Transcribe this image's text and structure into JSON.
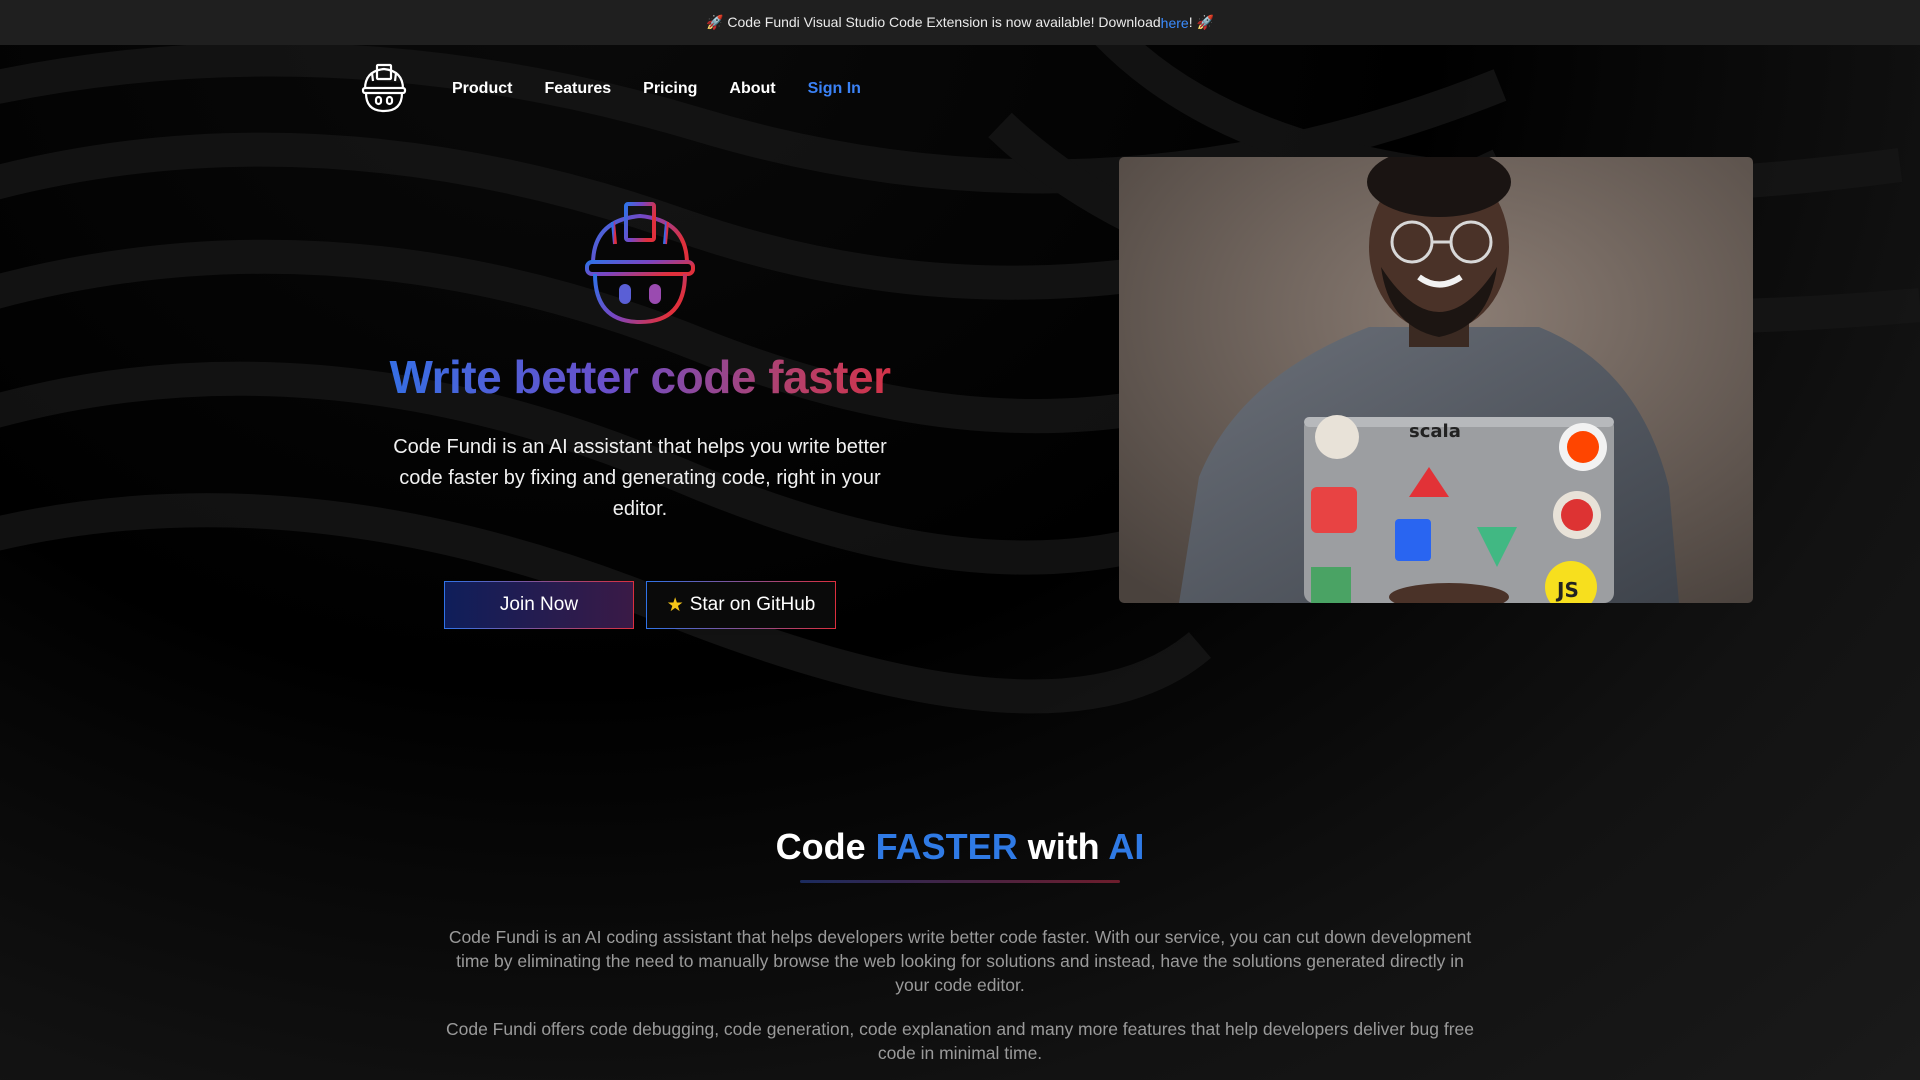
{
  "banner": {
    "prefix": "🚀 Code Fundi Visual Studio Code Extension is now available! Download ",
    "link": "here",
    "suffix": "! 🚀"
  },
  "nav": {
    "items": [
      {
        "label": "Product"
      },
      {
        "label": "Features"
      },
      {
        "label": "Pricing"
      },
      {
        "label": "About"
      }
    ],
    "sign_in": "Sign In"
  },
  "hero": {
    "title": "Write better code faster",
    "subtitle": "Code Fundi is an AI assistant that helps you write better code faster by fixing and generating code, right in your editor.",
    "join_label": "Join Now",
    "github_label": "Star on GitHub",
    "github_icon": "star-icon",
    "photo_stickers": {
      "scala": "scala",
      "js": "JS"
    }
  },
  "section": {
    "title_part1": "Code ",
    "title_hl1": "FASTER",
    "title_part2": " with ",
    "title_hl2": "AI",
    "para1": "Code Fundi is an AI coding assistant that helps developers write better code faster. With our service, you can cut down development time by eliminating the need to manually browse the web looking for solutions and instead, have the solutions generated directly in your code editor.",
    "para2": "Code Fundi offers code debugging, code generation, code explanation and many more features that help developers deliver bug free code in minimal time."
  },
  "colors": {
    "accent_blue": "#2f7ae5",
    "accent_red": "#dc2f3e",
    "banner_bg": "#1f1f1f"
  }
}
